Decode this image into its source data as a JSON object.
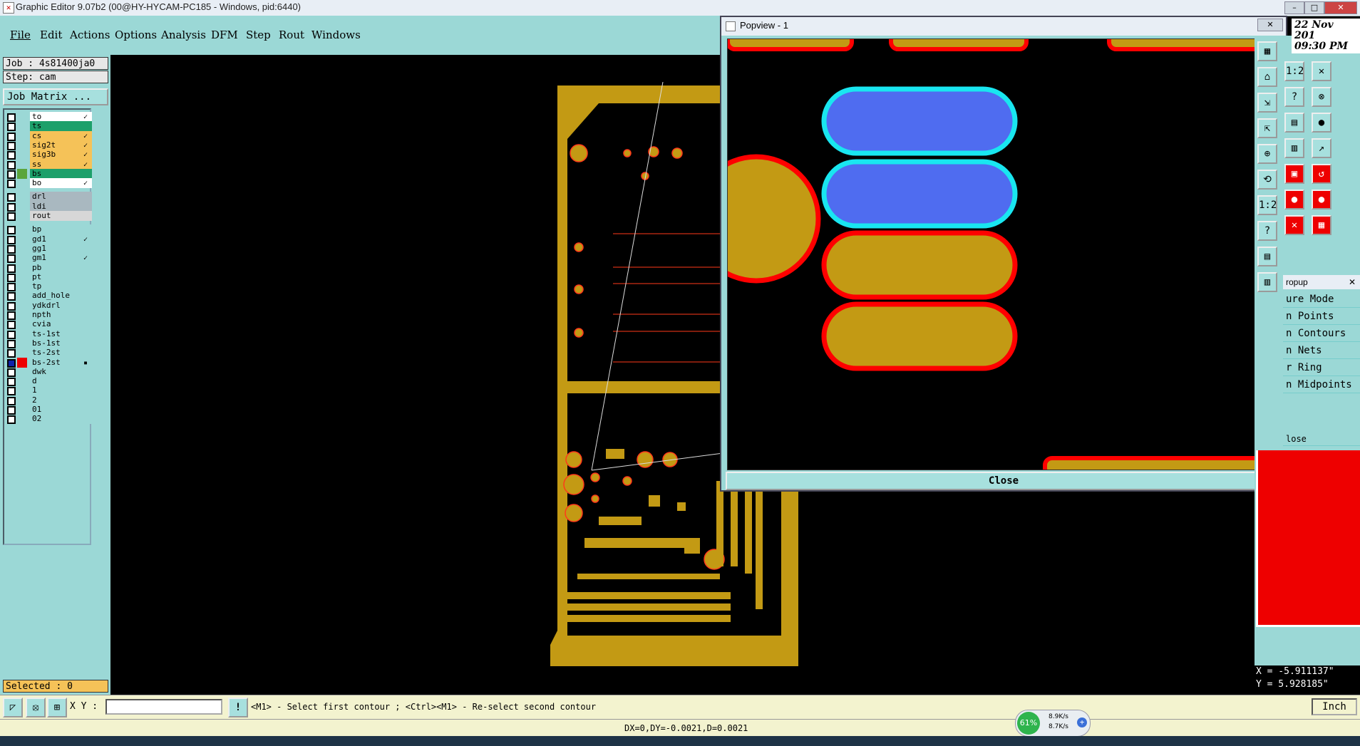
{
  "window": {
    "title": "Graphic Editor 9.07b2 (00@HY-HYCAM-PC185 - Windows, pid:6440)",
    "clock_date": "22 Nov 201",
    "clock_time": "09:30 PM"
  },
  "menu": [
    "File",
    "Edit",
    "Actions",
    "Options",
    "Analysis",
    "DFM",
    "Step",
    "Rout",
    "Windows"
  ],
  "job": {
    "job_line": "Job : 4s81400ja0",
    "step_line": "Step: cam",
    "matrix_button": "Job Matrix ..."
  },
  "layers": [
    {
      "name": "to",
      "color": "#ffffff",
      "mark": "✓"
    },
    {
      "name": "ts",
      "color": "#1da06a",
      "mark": ""
    },
    {
      "name": "cs",
      "color": "#f5c258",
      "mark": "✓"
    },
    {
      "name": "sig2t",
      "color": "#f5c258",
      "mark": "✓"
    },
    {
      "name": "sig3b",
      "color": "#f5c258",
      "mark": "✓"
    },
    {
      "name": "ss",
      "color": "#f5c258",
      "mark": "✓"
    },
    {
      "name": "bs",
      "color": "#1da06a",
      "mark": ""
    },
    {
      "name": "bo",
      "color": "#ffffff",
      "mark": "✓"
    },
    {
      "name": "drl",
      "color": "#a9b8c0",
      "mark": ""
    },
    {
      "name": "ldi",
      "color": "#a9b8c0",
      "mark": ""
    },
    {
      "name": "rout",
      "color": "#d7d7d7",
      "mark": ""
    },
    {
      "name": "bp",
      "color": "#9bd8d6",
      "mark": ""
    },
    {
      "name": "gd1",
      "color": "#9bd8d6",
      "mark": "✓"
    },
    {
      "name": "gg1",
      "color": "#9bd8d6",
      "mark": ""
    },
    {
      "name": "gm1",
      "color": "#9bd8d6",
      "mark": "✓"
    },
    {
      "name": "pb",
      "color": "#9bd8d6",
      "mark": ""
    },
    {
      "name": "pt",
      "color": "#9bd8d6",
      "mark": ""
    },
    {
      "name": "tp",
      "color": "#9bd8d6",
      "mark": ""
    },
    {
      "name": "add_hole",
      "color": "#9bd8d6",
      "mark": ""
    },
    {
      "name": "ydkdrl",
      "color": "#9bd8d6",
      "mark": ""
    },
    {
      "name": "npth",
      "color": "#9bd8d6",
      "mark": ""
    },
    {
      "name": "cvia",
      "color": "#9bd8d6",
      "mark": ""
    },
    {
      "name": "ts-1st",
      "color": "#9bd8d6",
      "mark": ""
    },
    {
      "name": "bs-1st",
      "color": "#9bd8d6",
      "mark": ""
    },
    {
      "name": "ts-2st",
      "color": "#9bd8d6",
      "mark": ""
    },
    {
      "name": "bs-2st",
      "color": "#9bd8d6",
      "mark": "▪"
    },
    {
      "name": "dwk",
      "color": "#9bd8d6",
      "mark": ""
    },
    {
      "name": "d",
      "color": "#9bd8d6",
      "mark": ""
    },
    {
      "name": "1",
      "color": "#9bd8d6",
      "mark": ""
    },
    {
      "name": "2",
      "color": "#9bd8d6",
      "mark": ""
    },
    {
      "name": "01",
      "color": "#9bd8d6",
      "mark": ""
    },
    {
      "name": "02",
      "color": "#9bd8d6",
      "mark": ""
    }
  ],
  "selected_label": "Selected : 0",
  "popview": {
    "title": "Popview - 1",
    "close": "Close"
  },
  "popup": {
    "title": "ropup",
    "items": [
      "ure Mode",
      "n Points",
      "n Contours",
      "n Nets",
      "r Ring",
      "n Midpoints"
    ],
    "close": "lose"
  },
  "readout": {
    "x": "X = -5.911137\"",
    "y": "Y = 5.928185\""
  },
  "command": {
    "xy_label": "X Y :",
    "xy_value": "",
    "prompt": "<M1> - Select first contour ; <Ctrl><M1> - Re-select second contour",
    "units": "Inch"
  },
  "status": {
    "delta": "DX=0,DY=-0.0021,D=0.0021",
    "net_percent": "61%",
    "net_up": "8.9K/s",
    "net_down": "8.7K/s"
  },
  "colors": {
    "copper": "#c39a14",
    "pad_outline": "#ff0000",
    "highlight_fill": "#4f6cf0",
    "highlight_outline": "#19e6f0",
    "panel": "#9bd8d6"
  }
}
